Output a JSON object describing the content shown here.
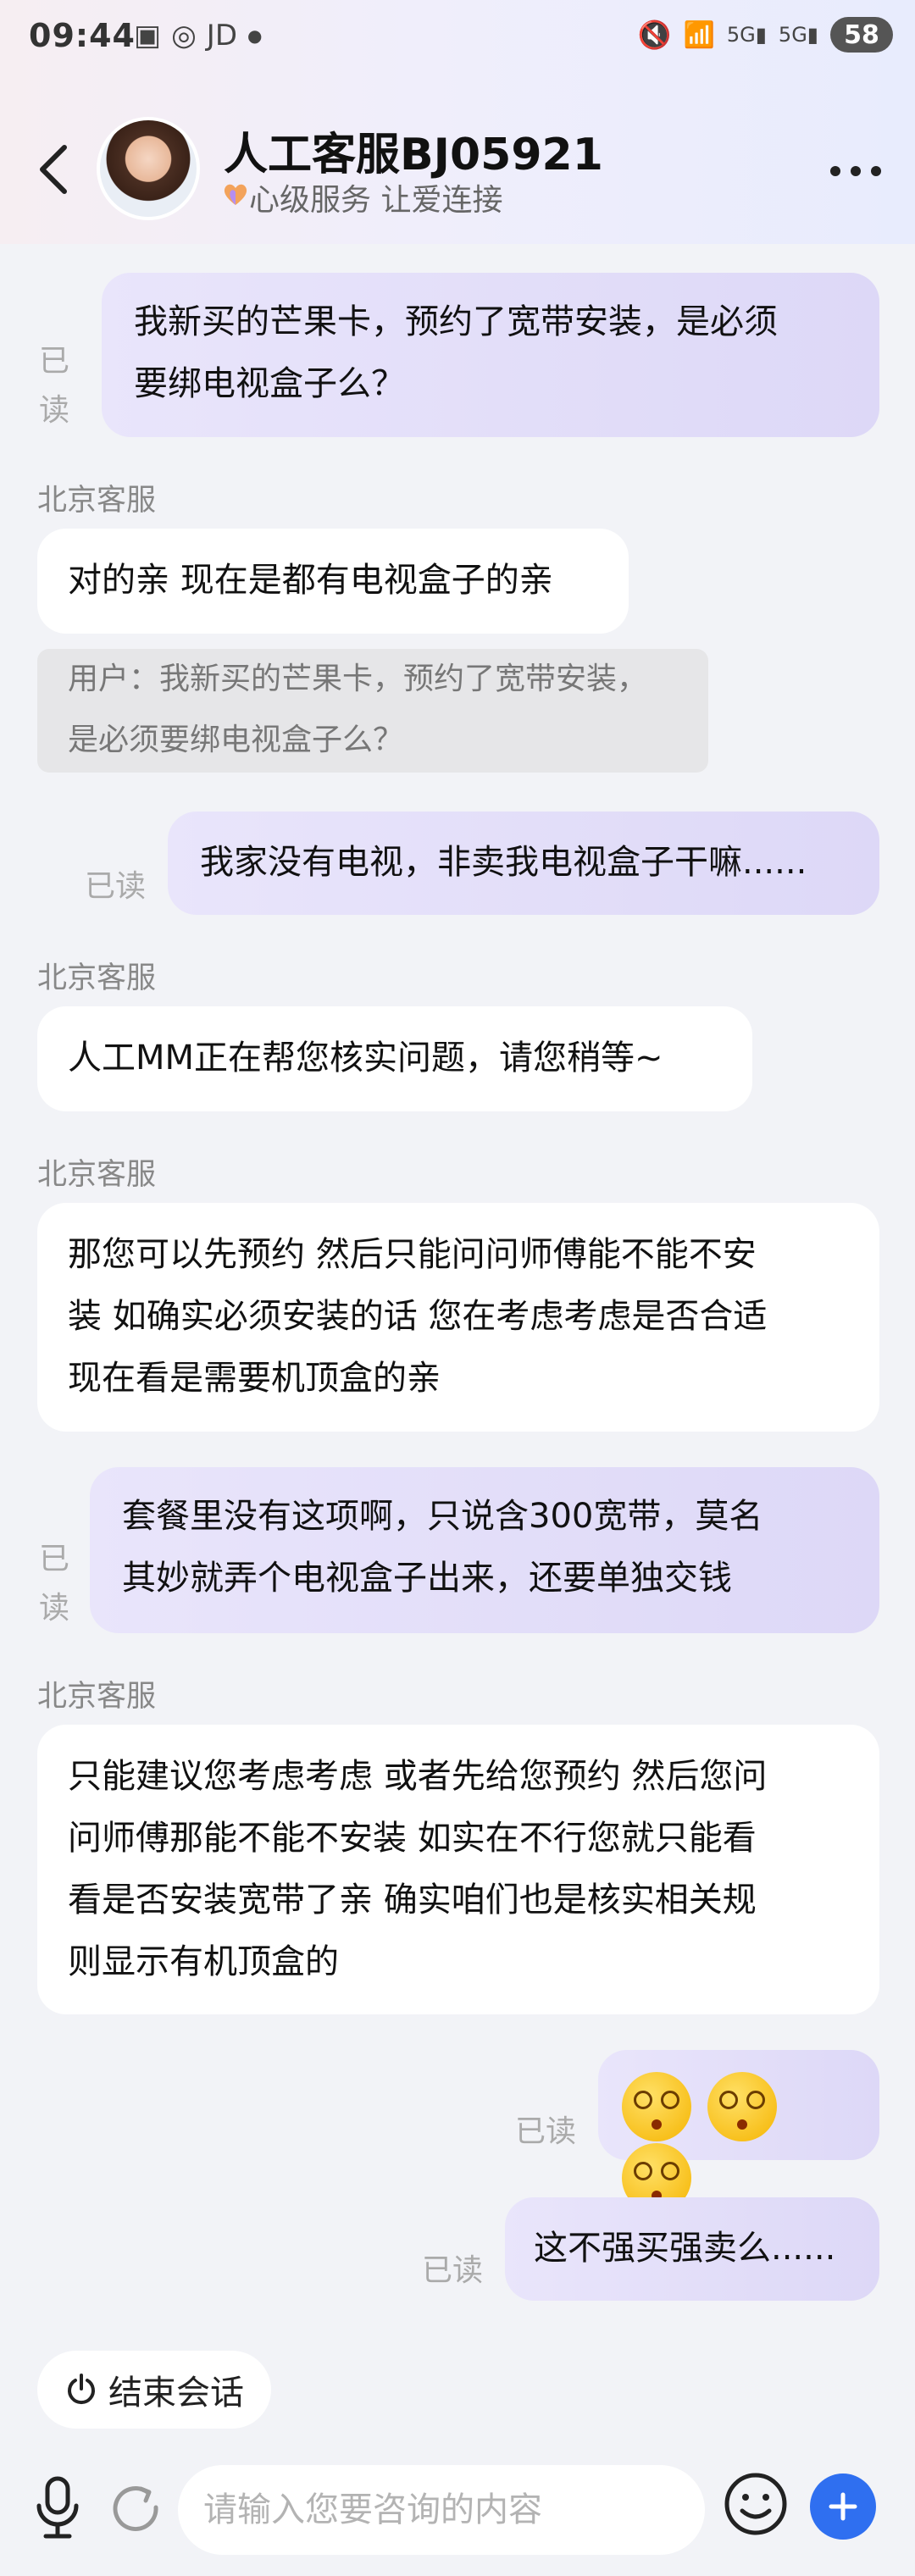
{
  "status_bar": {
    "time": "09:44",
    "apps": "JD",
    "battery": "58"
  },
  "header": {
    "title": "人工客服BJ05921",
    "subtitle": "心级服务 让爱连接"
  },
  "messages": [
    {
      "side": "right",
      "read_label": "已读",
      "lines": [
        "我新买的芒果卡，预约了宽带安装，是必须",
        "要绑电视盒子么？"
      ]
    },
    {
      "side": "left",
      "sender": "北京客服",
      "lines": [
        "对的亲 现在是都有电视盒子的亲"
      ],
      "quote_lines": [
        "用户：我新买的芒果卡，预约了宽带安装，",
        "是必须要绑电视盒子么？"
      ]
    },
    {
      "side": "right",
      "read_label": "已读",
      "lines": [
        "我家没有电视，非卖我电视盒子干嘛......"
      ]
    },
    {
      "side": "left",
      "sender": "北京客服",
      "lines": [
        "人工MM正在帮您核实问题，请您稍等~"
      ]
    },
    {
      "side": "left",
      "sender": "北京客服",
      "lines": [
        "那您可以先预约  然后只能问问师傅能不能不安",
        "装  如确实必须安装的话 您在考虑考虑是否合适",
        "现在看是需要机顶盒的亲"
      ]
    },
    {
      "side": "right",
      "read_label": "已读",
      "lines": [
        "套餐里没有这项啊，只说含300宽带，莫名",
        "其妙就弄个电视盒子出来，还要单独交钱"
      ]
    },
    {
      "side": "left",
      "sender": "北京客服",
      "lines": [
        "只能建议您考虑考虑 或者先给您预约 然后您问",
        "问师傅那能不能不安装 如实在不行您就只能看",
        "看是否安装宽带了亲  确实咱们也是核实相关规",
        "则显示有机顶盒的"
      ]
    },
    {
      "side": "right",
      "read_label": "已读",
      "emoji": "dizzy-face"
    },
    {
      "side": "right",
      "read_label": "已读",
      "lines": [
        "这不强买强卖么......"
      ]
    }
  ],
  "bottom": {
    "end_session_label": "结束会话",
    "input_placeholder": "请输入您要咨询的内容"
  },
  "colors": {
    "accent": "#2f6ff0",
    "right_bubble": "#e4e0fa",
    "background": "#f2f3f7"
  }
}
